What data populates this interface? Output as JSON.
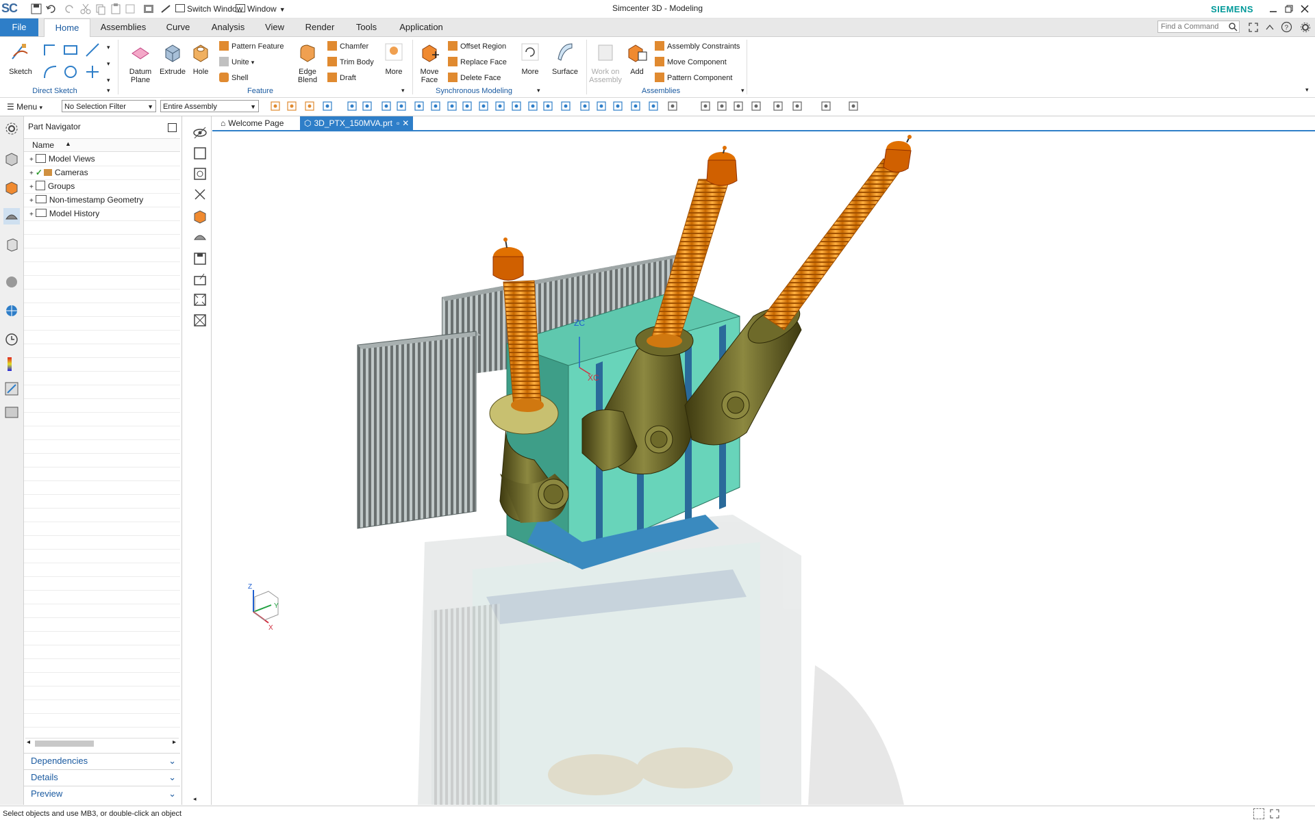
{
  "titlebar": {
    "app_logo": "SC",
    "switch_window": "Switch Window",
    "window_menu": "Window",
    "title": "Simcenter 3D - Modeling",
    "brand": "SIEMENS"
  },
  "ribbon_tabs": {
    "file": "File",
    "tabs": [
      "Home",
      "Assemblies",
      "Curve",
      "Analysis",
      "View",
      "Render",
      "Tools",
      "Application"
    ],
    "active": "Home",
    "find_placeholder": "Find a Command"
  },
  "ribbon": {
    "sketch": "Sketch",
    "direct_sketch": "Direct Sketch",
    "datum_plane": "Datum Plane",
    "extrude": "Extrude",
    "hole": "Hole",
    "pattern_feature": "Pattern Feature",
    "unite": "Unite",
    "shell": "Shell",
    "edge_blend": "Edge Blend",
    "chamfer": "Chamfer",
    "trim_body": "Trim Body",
    "draft": "Draft",
    "more_feature": "More",
    "feature_group": "Feature",
    "move_face": "Move Face",
    "offset_region": "Offset Region",
    "replace_face": "Replace Face",
    "delete_face": "Delete Face",
    "more_sync": "More",
    "surface": "Surface",
    "sync_group": "Synchronous Modeling",
    "work_on_assembly": "Work on Assembly",
    "add": "Add",
    "assembly_constraints": "Assembly Constraints",
    "move_component": "Move Component",
    "pattern_component": "Pattern Component",
    "assemblies_group": "Assemblies"
  },
  "toolbar": {
    "menu": "Menu",
    "selection_filter": "No Selection Filter",
    "scope": "Entire Assembly"
  },
  "navigator": {
    "title": "Part Navigator",
    "column_name": "Name",
    "items": [
      "Model Views",
      "Cameras",
      "Groups",
      "Non-timestamp Geometry",
      "Model History"
    ],
    "panels": [
      "Dependencies",
      "Details",
      "Preview"
    ]
  },
  "doc_tabs": [
    "Welcome Page",
    "3D_PTX_150MVA.prt"
  ],
  "viewport": {
    "wcs_z": "ZC",
    "wcs_x": "XC",
    "triad_z": "Z",
    "triad_y": "Y",
    "triad_x": "X"
  },
  "status": {
    "message": "Select objects and use MB3, or double-click an object"
  },
  "colors": {
    "accent": "#2e7ec8",
    "tank": "#5fc8ae",
    "bushing": "#f08a18",
    "turret": "#6e6a2a"
  }
}
